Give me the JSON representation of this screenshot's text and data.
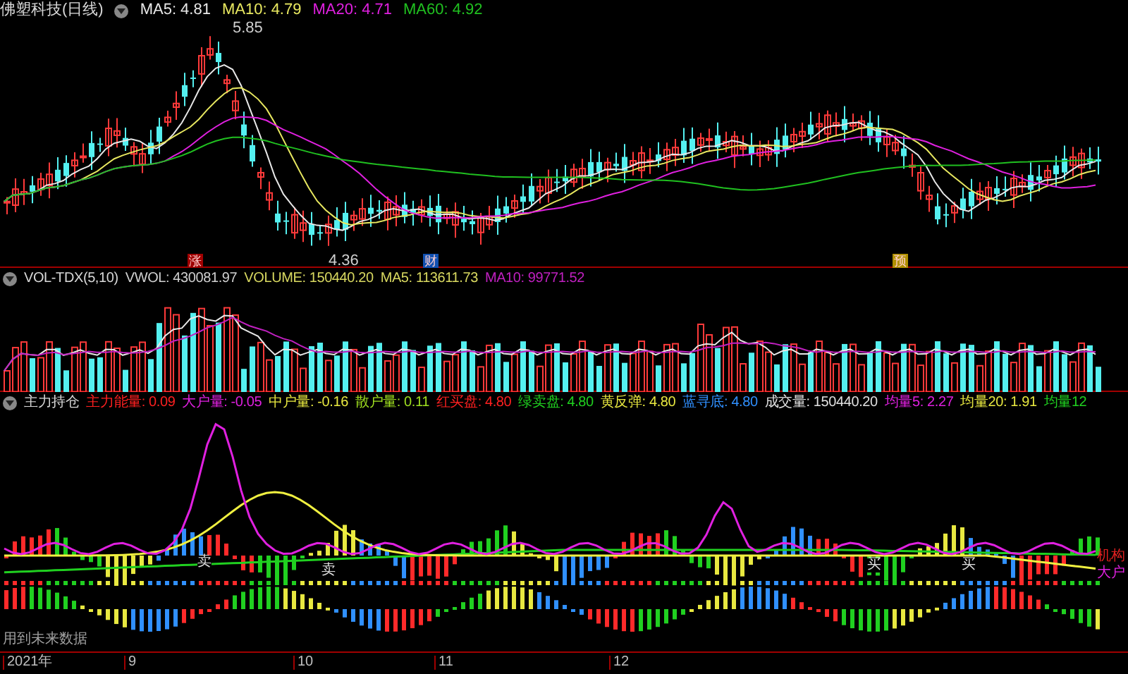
{
  "stock_header": {
    "title": "佛塑科技(日线)",
    "indicators": [
      {
        "label": "MA5: 4.81",
        "color": "#e8e8e8"
      },
      {
        "label": "MA10: 4.79",
        "color": "#e8e860"
      },
      {
        "label": "MA20: 4.71",
        "color": "#e020e0"
      },
      {
        "label": "MA60: 4.92",
        "color": "#20c020"
      }
    ]
  },
  "price_labels": {
    "high": "5.85",
    "low": "4.36"
  },
  "event_markers": [
    {
      "text": "涨",
      "color": "#a00000"
    },
    {
      "text": "财",
      "color": "#1050b0"
    },
    {
      "text": "预",
      "color": "#b09000"
    }
  ],
  "volume_header": {
    "title": "VOL-TDX(5,10)",
    "indicators": [
      {
        "label": "VWOL: 430081.97",
        "color": "#d0d0d0"
      },
      {
        "label": "VOLUME: 150440.20",
        "color": "#d8d860"
      },
      {
        "label": "MA5: 113611.73",
        "color": "#d8d860"
      },
      {
        "label": "MA10: 99771.52",
        "color": "#c020c0"
      }
    ]
  },
  "indicator_header": {
    "title": "主力持仓",
    "indicators": [
      {
        "label": "主力能量: 0.09",
        "color": "#ff2020"
      },
      {
        "label": "大户量: -0.05",
        "color": "#e020e0"
      },
      {
        "label": "中户量: -0.16",
        "color": "#e8e840"
      },
      {
        "label": "散户量: 0.11",
        "color": "#a0e020"
      },
      {
        "label": "红买盘: 4.80",
        "color": "#ff2020"
      },
      {
        "label": "绿卖盘: 4.80",
        "color": "#20d020"
      },
      {
        "label": "黄反弹: 4.80",
        "color": "#e8e840"
      },
      {
        "label": "蓝寻底: 4.80",
        "color": "#3090ff"
      },
      {
        "label": "成交量: 150440.20",
        "color": "#e0e0e0"
      },
      {
        "label": "均量5: 2.27",
        "color": "#e020e0"
      },
      {
        "label": "均量20: 1.91",
        "color": "#e8e840"
      },
      {
        "label": "均量12",
        "color": "#20d020"
      }
    ]
  },
  "signal_labels": [
    "卖",
    "卖",
    "买",
    "买"
  ],
  "line_labels": [
    {
      "text": "机构",
      "color": "#e02020"
    },
    {
      "text": "大户",
      "color": "#e020e0"
    }
  ],
  "future_data_note": "用到未来数据",
  "date_axis": [
    "2021年",
    "9",
    "10",
    "11",
    "12"
  ]
}
